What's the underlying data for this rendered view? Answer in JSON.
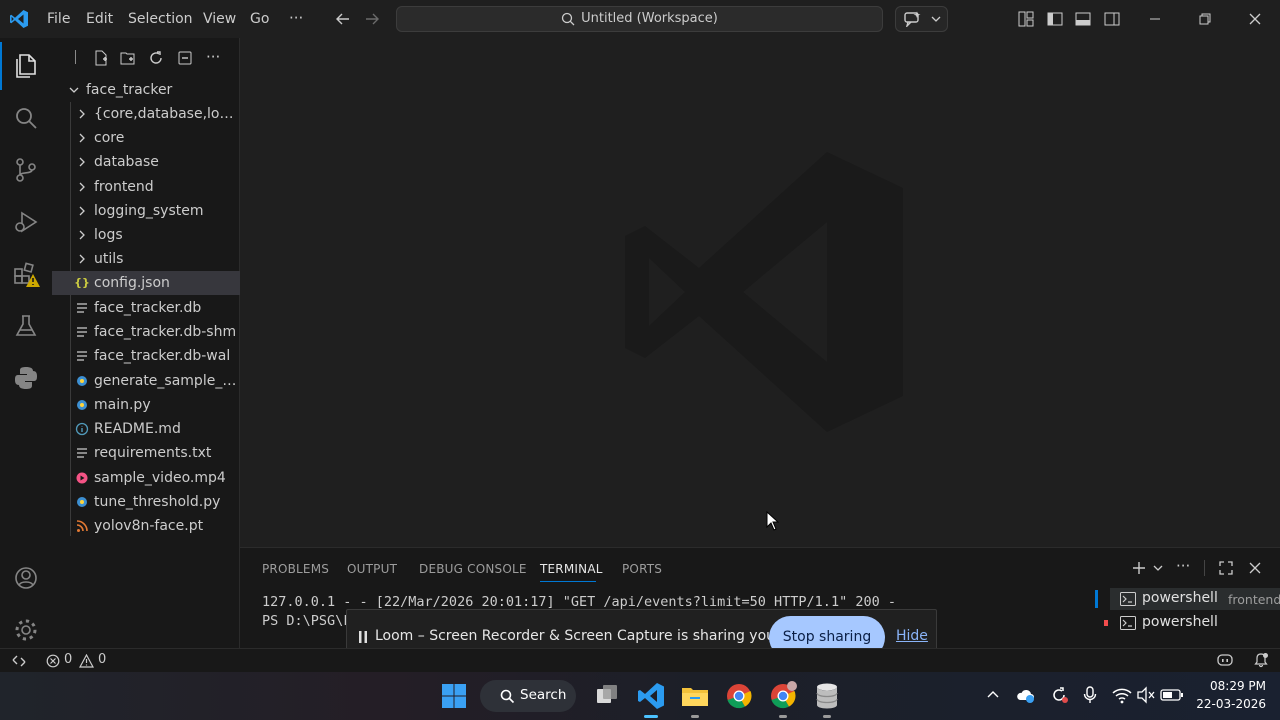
{
  "menu": [
    "File",
    "Edit",
    "Selection",
    "View",
    "Go"
  ],
  "command_center": "Untitled (Workspace)",
  "explorer": {
    "root": "face_tracker",
    "items": [
      {
        "label": "{core,database,loggi...",
        "type": "folder"
      },
      {
        "label": "core",
        "type": "folder"
      },
      {
        "label": "database",
        "type": "folder"
      },
      {
        "label": "frontend",
        "type": "folder"
      },
      {
        "label": "logging_system",
        "type": "folder"
      },
      {
        "label": "logs",
        "type": "folder"
      },
      {
        "label": "utils",
        "type": "folder"
      },
      {
        "label": "config.json",
        "type": "json"
      },
      {
        "label": "face_tracker.db",
        "type": "db"
      },
      {
        "label": "face_tracker.db-shm",
        "type": "db"
      },
      {
        "label": "face_tracker.db-wal",
        "type": "db"
      },
      {
        "label": "generate_sample_ou...",
        "type": "python"
      },
      {
        "label": "main.py",
        "type": "python"
      },
      {
        "label": "README.md",
        "type": "info"
      },
      {
        "label": "requirements.txt",
        "type": "text"
      },
      {
        "label": "sample_video.mp4",
        "type": "video"
      },
      {
        "label": "tune_threshold.py",
        "type": "python"
      },
      {
        "label": "yolov8n-face.pt",
        "type": "rss"
      }
    ]
  },
  "panel": {
    "tabs": [
      "PROBLEMS",
      "OUTPUT",
      "DEBUG CONSOLE",
      "TERMINAL",
      "PORTS"
    ],
    "active_tab": "TERMINAL",
    "terminal_lines": [
      "127.0.0.1 - - [22/Mar/2026 20:01:17] \"GET /api/events?limit=50 HTTP/1.1\" 200 -",
      "PS D:\\PSG\\F"
    ],
    "terminals": [
      {
        "name": "powershell",
        "detail": "frontend"
      },
      {
        "name": "powershell",
        "detail": ""
      }
    ]
  },
  "loom": {
    "message": "Loom – Screen Recorder & Screen Capture is sharing your screen.",
    "stop_label": "Stop sharing",
    "hide_label": "Hide"
  },
  "status": {
    "errors": "0",
    "warnings": "0"
  },
  "taskbar": {
    "search_label": "Search",
    "time": "08:29 PM",
    "date": "22-03-2026"
  },
  "colors": {
    "accent": "#0078d4",
    "json_icon": "#cbcb41",
    "python_icon": "#3d8fd1",
    "video_icon": "#f55385",
    "rss_icon": "#e37933",
    "warning": "#cca700"
  }
}
